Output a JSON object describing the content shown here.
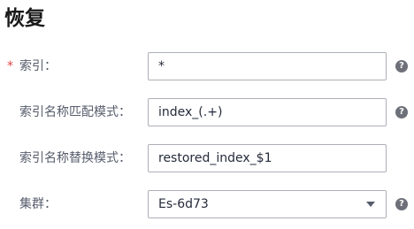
{
  "title": "恢复",
  "fields": [
    {
      "label": "索引：",
      "required_mark": "*",
      "value": "*"
    },
    {
      "label": "索引名称匹配模式：",
      "value": "index_(.+)"
    },
    {
      "label": "索引名称替换模式：",
      "value": "restored_index_$1"
    },
    {
      "label": "集群：",
      "selected": "Es-6d73"
    }
  ],
  "icons": {
    "help": "question-circle-icon",
    "dropdown": "caret-down-icon"
  },
  "help_glyph": "?",
  "colors": {
    "required": "#e54545",
    "border": "#adb0b8",
    "label": "#575d6c",
    "help_icon": "#6d7078"
  }
}
